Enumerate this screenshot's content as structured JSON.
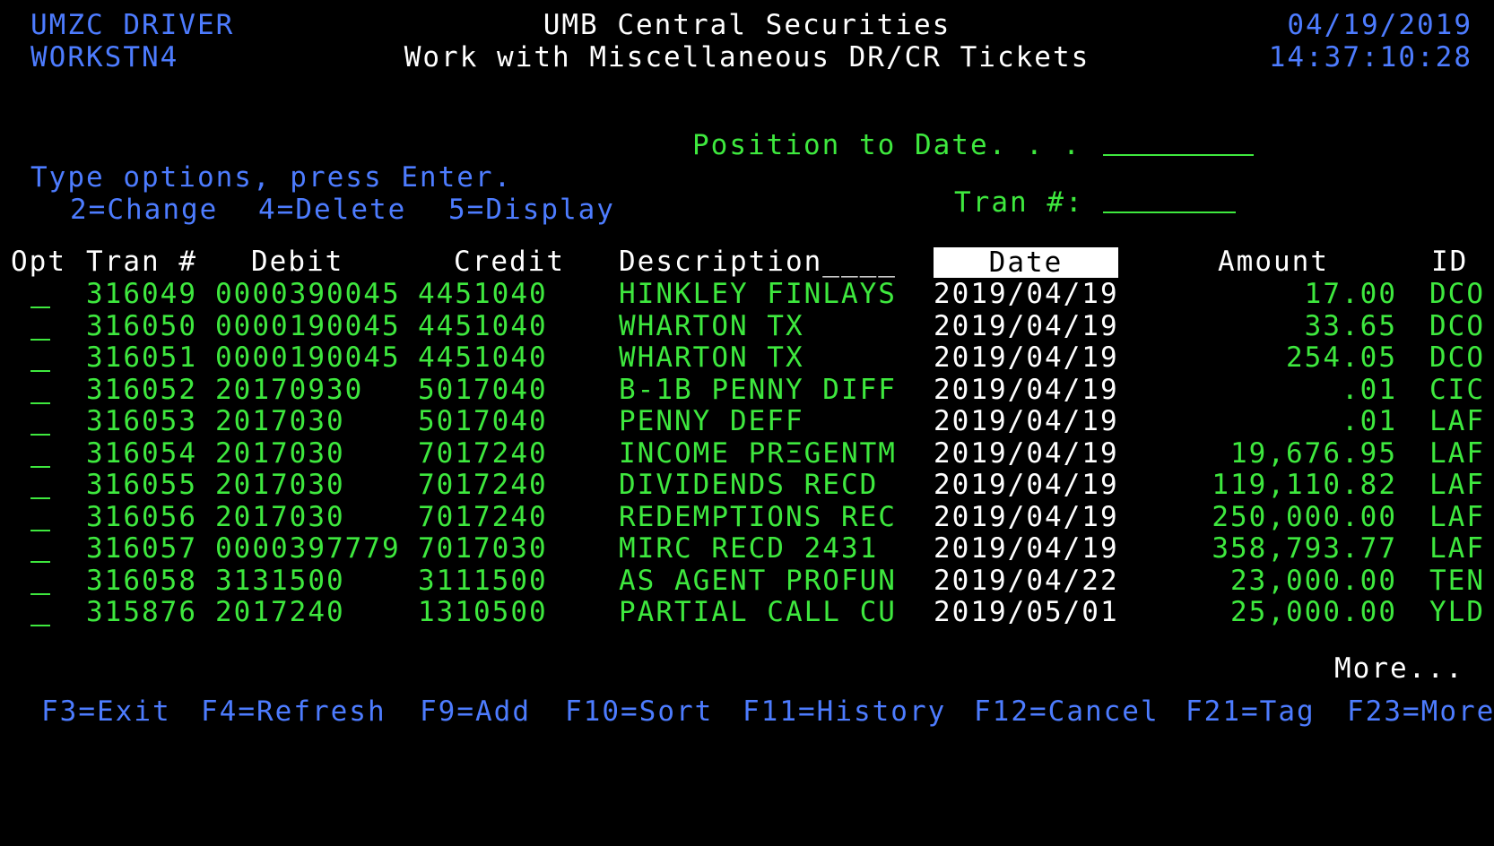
{
  "header": {
    "user": "UMZC DRIVER",
    "workstation": "WORKSTN4",
    "title": "UMB Central Securities",
    "subtitle": "Work with Miscellaneous DR/CR Tickets",
    "date": "04/19/2019",
    "time": "14:37:10:28"
  },
  "position": {
    "label": "Position to Date. . .",
    "value": ""
  },
  "tran_filter": {
    "label": "Tran #:",
    "value": ""
  },
  "instructions": {
    "line1": "Type options, press Enter.",
    "opt_change": "2=Change",
    "opt_delete": "4=Delete",
    "opt_display": "5=Display"
  },
  "columns": {
    "opt": "Opt",
    "tran": "Tran #",
    "debit": "Debit",
    "credit": "Credit",
    "description": "Description____",
    "date": "Date",
    "amount": "Amount",
    "id": "ID"
  },
  "rows": [
    {
      "tran": "316049",
      "debit": "0000390045",
      "credit": "4451040",
      "description": "HINKLEY FINLAYS",
      "date": "2019/04/19",
      "amount": "17.00",
      "id": "DCO"
    },
    {
      "tran": "316050",
      "debit": "0000190045",
      "credit": "4451040",
      "description": "WHARTON TX",
      "date": "2019/04/19",
      "amount": "33.65",
      "id": "DCO"
    },
    {
      "tran": "316051",
      "debit": "0000190045",
      "credit": "4451040",
      "description": "WHARTON TX",
      "date": "2019/04/19",
      "amount": "254.05",
      "id": "DCO"
    },
    {
      "tran": "316052",
      "debit": "20170930",
      "credit": "5017040",
      "description": "B-1B PENNY DIFF",
      "date": "2019/04/19",
      "amount": ".01",
      "id": "CIC"
    },
    {
      "tran": "316053",
      "debit": "2017030",
      "credit": "5017040",
      "description": "PENNY DEFF",
      "date": "2019/04/19",
      "amount": ".01",
      "id": "LAF"
    },
    {
      "tran": "316054",
      "debit": "2017030",
      "credit": "7017240",
      "description": "INCOME PRΞGENTM",
      "date": "2019/04/19",
      "amount": "19,676.95",
      "id": "LAF"
    },
    {
      "tran": "316055",
      "debit": "2017030",
      "credit": "7017240",
      "description": "DIVIDENDS RECD",
      "date": "2019/04/19",
      "amount": "119,110.82",
      "id": "LAF"
    },
    {
      "tran": "316056",
      "debit": "2017030",
      "credit": "7017240",
      "description": "REDEMPTIONS REC",
      "date": "2019/04/19",
      "amount": "250,000.00",
      "id": "LAF"
    },
    {
      "tran": "316057",
      "debit": "0000397779",
      "credit": "7017030",
      "description": "MIRC RECD 2431",
      "date": "2019/04/19",
      "amount": "358,793.77",
      "id": "LAF"
    },
    {
      "tran": "316058",
      "debit": "3131500",
      "credit": "3111500",
      "description": "AS AGENT PROFUN",
      "date": "2019/04/22",
      "amount": "23,000.00",
      "id": "TEN"
    },
    {
      "tran": "315876",
      "debit": "2017240",
      "credit": "1310500",
      "description": "PARTIAL CALL CU",
      "date": "2019/05/01",
      "amount": "25,000.00",
      "id": "YLD"
    }
  ],
  "more": "More...",
  "function_keys": [
    {
      "label": "F3=Exit"
    },
    {
      "label": "F4=Refresh"
    },
    {
      "label": "F9=Add"
    },
    {
      "label": "F10=Sort"
    },
    {
      "label": "F11=History"
    },
    {
      "label": "F12=Cancel"
    },
    {
      "label": "F21=Tag"
    },
    {
      "label": "F23=More"
    }
  ],
  "colors": {
    "background": "#000000",
    "blue": "#4d7cff",
    "green": "#3ee83e",
    "white": "#ffffff"
  }
}
